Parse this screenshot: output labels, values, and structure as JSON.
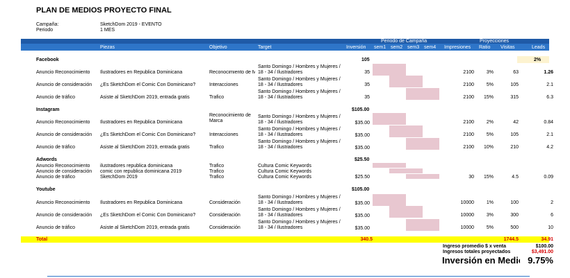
{
  "title": "PLAN DE MEDIOS PROYECTO FINAL",
  "meta": {
    "campaign_label": "Campaña:",
    "campaign_value": "SketchDom 2019 - EVENTO",
    "period_label": "Periodo",
    "period_value": "1 MES"
  },
  "header": {
    "periodo_campana": "Periodo de Campaña",
    "proyecciones": "Proyecciones",
    "cols": {
      "piezas": "Piezas",
      "objetivo": "Objetivo",
      "target": "Target",
      "inversion": "Inversión",
      "sem1": "sem1",
      "sem2": "sem2",
      "sem3": "sem3",
      "sem4": "sem4",
      "impresiones": "Impresiones",
      "ratio": "Ratio",
      "visitas": "Visitas",
      "leads": "Leads"
    }
  },
  "sections": {
    "facebook": {
      "name": "Facebook",
      "total": "105",
      "leads_pct": "2%",
      "rows": [
        {
          "tipo": "Anuncio Reconocimiento",
          "pieza": "Ilustradores en Republica Dominicana",
          "objetivo": "Reconocimiento de M",
          "target": "Santo Domingo / Hombres y Mujeres / 18 - 34 / Ilustradores",
          "inversion": "35",
          "impresiones": "2100",
          "ratio": "3%",
          "visitas": "63",
          "leads": "1.26"
        },
        {
          "tipo": "Anuncio de consideración",
          "pieza": "¿Es SketchDom el Comic Con Dominicano?",
          "objetivo": "Interacciones",
          "target": "Santo Domingo / Hombres y Mujeres / 18 - 34 / Ilustradores",
          "inversion": "35",
          "impresiones": "2100",
          "ratio": "5%",
          "visitas": "105",
          "leads": "2.1"
        },
        {
          "tipo": "Anuncio de tráfico",
          "pieza": "Asiste al SketchDom 2019, entrada gratis",
          "objetivo": "Trafico",
          "target": "Santo Domingo / Hombres y Mujeres / 18 - 34 / Ilustradores",
          "inversion": "35",
          "impresiones": "2100",
          "ratio": "15%",
          "visitas": "315",
          "leads": "6.3"
        }
      ]
    },
    "instagram": {
      "name": "Instagram",
      "total": "$105.00",
      "rows": [
        {
          "tipo": "Anuncio Reconocimiento",
          "pieza": "Ilustradores en Republica Dominicana",
          "objetivo": "Reconocimiento de Marca",
          "target": "Santo Domingo / Hombres y Mujeres / 18 - 34 / Ilustradores",
          "inversion": "$35.00",
          "impresiones": "2100",
          "ratio": "2%",
          "visitas": "42",
          "leads": "0.84"
        },
        {
          "tipo": "Anuncio de consideración",
          "pieza": "¿Es SketchDom el Comic Con Dominicano?",
          "objetivo": "Interacciones",
          "target": "Santo Domingo / Hombres y Mujeres / 18 - 34 / Ilustradores",
          "inversion": "$35.00",
          "impresiones": "2100",
          "ratio": "5%",
          "visitas": "105",
          "leads": "2.1"
        },
        {
          "tipo": "Anuncio de tráfico",
          "pieza": "Asiste al SketchDom 2019, entrada gratis",
          "objetivo": "Trafico",
          "target": "Santo Domingo / Hombres y Mujeres / 18 - 34 / Ilustradores",
          "inversion": "$35.00",
          "impresiones": "2100",
          "ratio": "10%",
          "visitas": "210",
          "leads": "4.2"
        }
      ]
    },
    "adwords": {
      "name": "Adwords",
      "total": "$25.50",
      "rows": [
        {
          "tipo": "Anuncio Reconocimiento",
          "pieza": "ilustradores republica dominicana",
          "objetivo": "Trafico",
          "target": "Cultura Comic Keywords"
        },
        {
          "tipo": "Anuncio de consideración",
          "pieza": "comic con republica dominicana 2019",
          "objetivo": "Trafico",
          "target": "Cultura Comic Keywords"
        },
        {
          "tipo": "Anuncio de tráfico",
          "pieza": "SketchDom 2019",
          "objetivo": "Trafico",
          "target": "Cultura Comic Keywords",
          "inversion": "$25.50",
          "impresiones": "30",
          "ratio": "15%",
          "visitas": "4.5",
          "leads": "0.09"
        }
      ]
    },
    "youtube": {
      "name": "Youtube",
      "total": "$105.00",
      "rows": [
        {
          "tipo": "Anuncio Reconocimiento",
          "pieza": "Ilustradores en Republica Dominicana",
          "objetivo": "Consideración",
          "target": "Santo Domingo / Hombres y Mujeres / 18 - 34 / Ilustradores",
          "inversion": "$35.00",
          "impresiones": "10000",
          "ratio": "1%",
          "visitas": "100",
          "leads": "2"
        },
        {
          "tipo": "Anuncio de consideración",
          "pieza": "¿Es SketchDom el Comic Con Dominicano?",
          "objetivo": "Consideración",
          "target": "Santo Domingo / Hombres y Mujeres / 18 - 34 / Ilustradores",
          "inversion": "$35.00",
          "impresiones": "10000",
          "ratio": "3%",
          "visitas": "300",
          "leads": "6"
        },
        {
          "tipo": "Anuncio de tráfico",
          "pieza": "Asiste al SketchDom 2019, entrada gratis",
          "objetivo": "Consideración",
          "target": "Santo Domingo / Hombres y Mujeres / 18 - 34 / Ilustradores",
          "inversion": "$35.00",
          "impresiones": "10000",
          "ratio": "5%",
          "visitas": "500",
          "leads": "10"
        }
      ]
    }
  },
  "totals": {
    "label": "Total",
    "inversion": "340.5",
    "visitas": "1744.5",
    "leads": "34.91"
  },
  "summary": {
    "ingreso_label": "Ingreso promedio $ x venta",
    "ingreso_value": "$100.00",
    "ingresos_label": "Ingresos totales proyectados",
    "ingresos_value": "$3,491.00",
    "inversion_label": "Inversión en Medio",
    "inversion_value": "9.75%"
  },
  "colors": {
    "header_dark": "#1f5aa6",
    "header_light": "#2e75c8",
    "gantt": "#e8c7d0",
    "total_bar": "#ffff00",
    "leads_highlight": "#fdf3d0"
  }
}
